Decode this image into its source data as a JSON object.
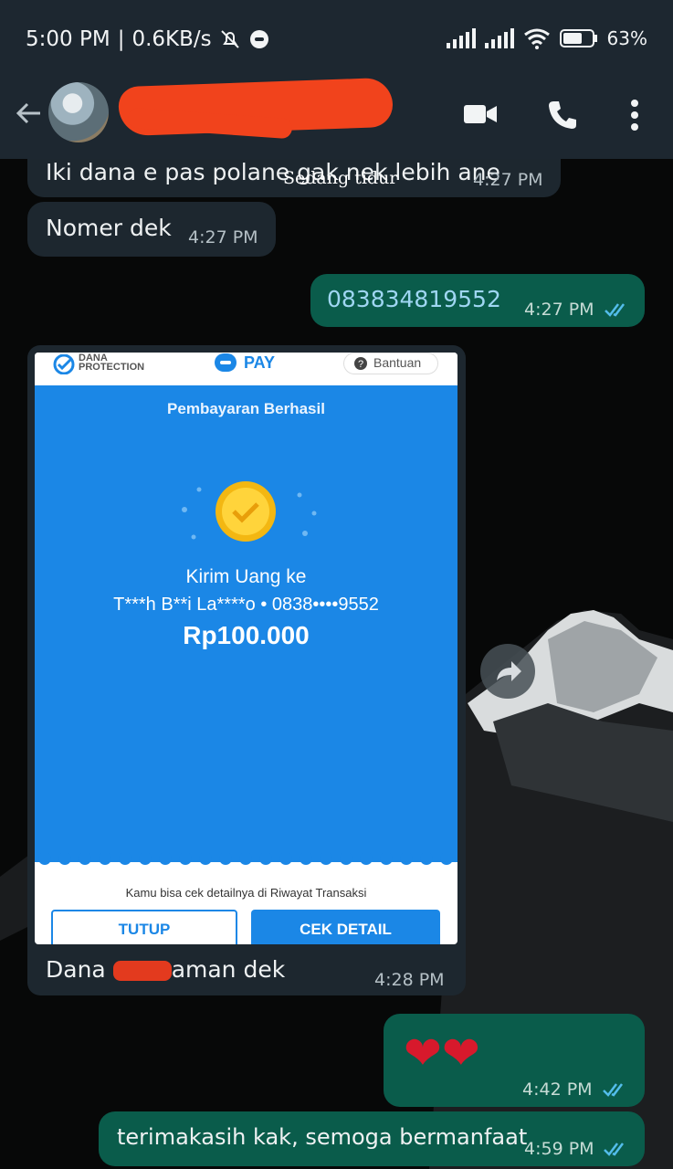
{
  "status_bar": {
    "time": "5:00 PM",
    "speed": "0.6KB/s",
    "battery": "63%"
  },
  "chat_header": {
    "icons": [
      "back-arrow-icon",
      "video-call-icon",
      "voice-call-icon",
      "more-vert-icon"
    ]
  },
  "messages": [
    {
      "direction": "in",
      "text": "Iki dana e pas polane gak nek lebih ane",
      "overlay": "Sedang tidur",
      "time": "4:27 PM"
    },
    {
      "direction": "in",
      "text": "Nomer dek",
      "time": "4:27 PM"
    },
    {
      "direction": "out",
      "text": "083834819552",
      "time": "4:27 PM",
      "read": true
    },
    {
      "direction": "in",
      "type": "image",
      "caption_left": "Dana ",
      "caption_right": "aman dek",
      "time": "4:28 PM",
      "receipt": {
        "brand": "DANA",
        "brand_sub": "PROTECTION",
        "pay_label": "PAY",
        "help": "Bantuan",
        "title": "Pembayaran Berhasil",
        "subtitle": "Kirim Uang ke",
        "recipient": "T***h B**i La****o • 0838••••9552",
        "amount": "Rp100.000",
        "note": "Kamu bisa cek detailnya di Riwayat Transaksi",
        "btn_close": "TUTUP",
        "btn_detail": "CEK DETAIL"
      }
    },
    {
      "direction": "out",
      "text": "❤❤",
      "time": "4:42 PM",
      "read": true
    },
    {
      "direction": "out",
      "text": "terimakasih kak, semoga bermanfaat",
      "time": "4:59 PM",
      "read": true
    }
  ],
  "colors": {
    "bar": "#1d2730",
    "incoming": "#1d272f",
    "outgoing": "#0a5c4b",
    "read_ticks": "#53bdeb",
    "dana_blue": "#1b87e6"
  }
}
